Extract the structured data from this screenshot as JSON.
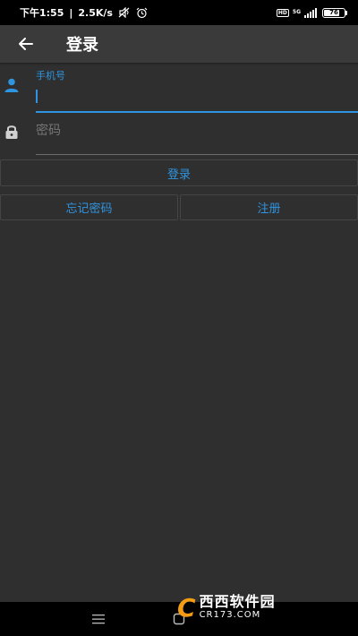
{
  "status_bar": {
    "time": "下午1:55",
    "speed": "2.5K/s",
    "network": "5G",
    "battery": "76",
    "battery_level": 0.76
  },
  "app_bar": {
    "back_icon": "arrow-back-icon",
    "title": "登录"
  },
  "form": {
    "phone": {
      "icon": "person-icon",
      "label": "手机号",
      "value": ""
    },
    "password": {
      "icon": "lock-icon",
      "placeholder": "密码",
      "value": ""
    },
    "login_button": "登录",
    "forgot_button": "忘记密码",
    "register_button": "注册"
  },
  "nav_bar": {
    "menu_icon": "menu-icon",
    "home_icon": "home-square-icon"
  },
  "watermark": {
    "logo": "C",
    "cn": "西西软件园",
    "en": "CR173.COM"
  },
  "colors": {
    "accent": "#2f95e0",
    "background": "#2f2f2f",
    "app_bar": "#3a3a3a",
    "watermark_orange": "#f39b13"
  }
}
